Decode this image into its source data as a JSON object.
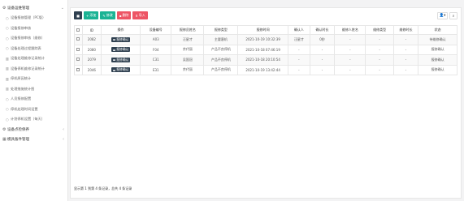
{
  "sidebar": {
    "group1": {
      "label": "设备运维管理",
      "icon": "gears-icon"
    },
    "items": [
      {
        "label": "设备报修管理（PC版）",
        "icon": "○"
      },
      {
        "label": "设备报修审核",
        "icon": "○"
      },
      {
        "label": "设备报修审核（维修）",
        "icon": "○"
      },
      {
        "label": "设备处理过程跟踪表",
        "icon": "○"
      },
      {
        "label": "设备处理维修记录统计",
        "icon": "▥"
      },
      {
        "label": "设备停机维修记录统计",
        "icon": "▥"
      },
      {
        "label": "停机原因统计",
        "icon": "▥"
      },
      {
        "label": "处理措施统计图",
        "icon": "▥"
      },
      {
        "label": "人员报修配置",
        "icon": "○"
      },
      {
        "label": "停机处理时间设置",
        "icon": "○"
      },
      {
        "label": "计划停机设置（每天）",
        "icon": "○"
      }
    ],
    "group2": {
      "label": "设备点检保养",
      "icon": "gears-icon"
    },
    "group3": {
      "label": "模具备件管理",
      "icon": "grid-icon"
    }
  },
  "toolbar": {
    "add_label": "添加",
    "edit_label": "修改",
    "delete_label": "删除",
    "import_label": "导入"
  },
  "table": {
    "headers": [
      "",
      "ID",
      "操作",
      "设备编号",
      "报修员姓名",
      "报修类型",
      "报修时间",
      "确认人",
      "确认时长",
      "维修人姓名",
      "维修类型",
      "维修时长",
      "状态"
    ],
    "op_label": "报修确认",
    "rows": [
      {
        "id": "2082",
        "code": "A03",
        "name": "汪星才",
        "type": "主要客机",
        "time": "2021-10-19 10:32:39",
        "confirmer": "汪星才",
        "confirm_dur": "0秒",
        "repairer": "-",
        "repair_type": "-",
        "repair_dur": "-",
        "status": "待维修确认"
      },
      {
        "id": "2080",
        "code": "F04",
        "name": "余代丽",
        "type": "产品不良停机",
        "time": "2021-10-18 07:46:19",
        "confirmer": "-",
        "confirm_dur": "-",
        "repairer": "-",
        "repair_type": "-",
        "repair_dur": "-",
        "status": "报修确认"
      },
      {
        "id": "2079",
        "code": "C31",
        "name": "吴国冠",
        "type": "产品不良停机",
        "time": "2021-10-18 20:10:54",
        "confirmer": "-",
        "confirm_dur": "-",
        "repairer": "-",
        "repair_type": "-",
        "repair_dur": "-",
        "status": "报修确认"
      },
      {
        "id": "2046",
        "code": "E31",
        "name": "余代丽",
        "type": "产品不良停机",
        "time": "2021-10-19 13:42:44",
        "confirmer": "-",
        "confirm_dur": "-",
        "repairer": "-",
        "repair_type": "-",
        "repair_dur": "-",
        "status": "报修确认"
      }
    ]
  },
  "footer": {
    "text": "显示第 1 到第 4 条记录，总共 4 条记录"
  }
}
